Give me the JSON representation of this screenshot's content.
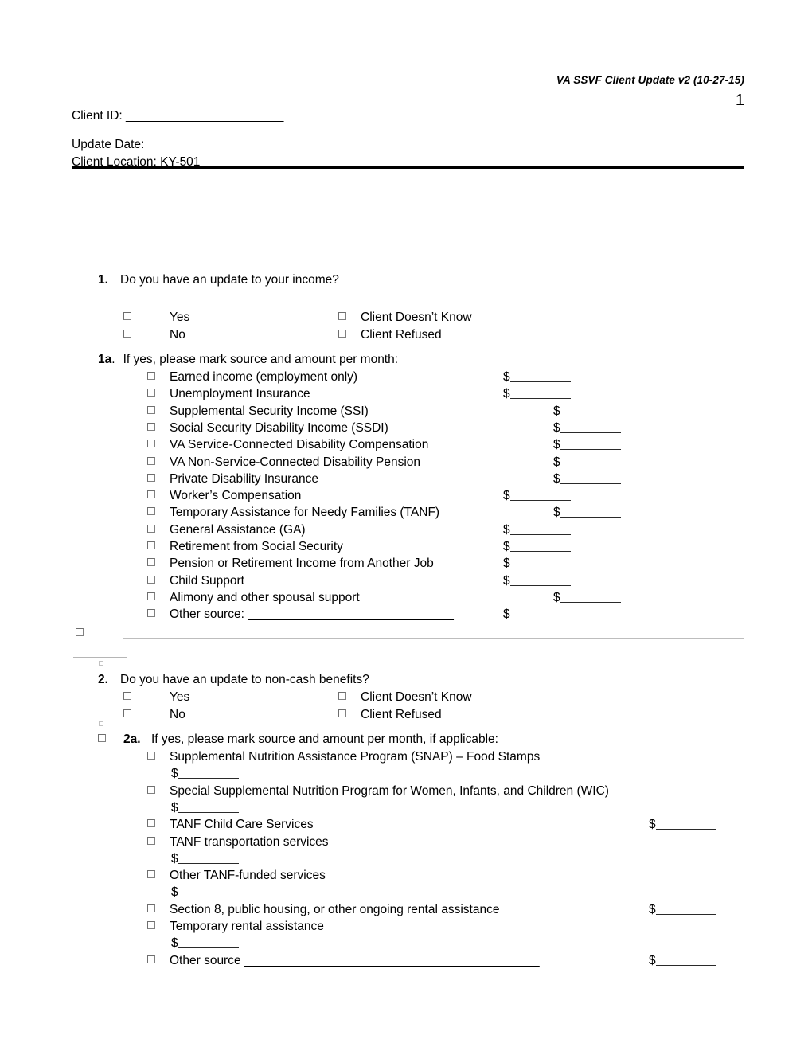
{
  "header": {
    "doc_title": "VA SSVF Client Update v2 (10-27-15)",
    "page_number": "1"
  },
  "client_info": {
    "client_id_label": "Client ID: _______________________",
    "update_date_label": "Update Date: ____________________",
    "client_location_label": "Client Location: KY-501"
  },
  "question1": {
    "number": "1.",
    "text": "Do you have an update to your income?",
    "options": [
      {
        "label": "Yes"
      },
      {
        "label": "No"
      },
      {
        "label": "Client Doesn’t Know"
      },
      {
        "label": "Client Refused"
      }
    ],
    "sub": {
      "number": "1a",
      "dot": ".",
      "text": "If yes, please mark source and amount per month:"
    },
    "sources": [
      {
        "label": "Earned income (employment only)",
        "amount_symbol": "$",
        "amount_col": "left"
      },
      {
        "label": "Unemployment Insurance",
        "amount_symbol": "$",
        "amount_col": "left"
      },
      {
        "label": "Supplemental Security Income (SSI)",
        "amount_symbol": "$",
        "amount_col": "right"
      },
      {
        "label": "Social Security Disability Income (SSDI)",
        "amount_symbol": "$",
        "amount_col": "right"
      },
      {
        "label": "VA Service-Connected Disability Compensation",
        "amount_symbol": "$",
        "amount_col": "right"
      },
      {
        "label": "VA Non-Service-Connected Disability Pension",
        "amount_symbol": "$",
        "amount_col": "right"
      },
      {
        "label": "Private Disability Insurance",
        "amount_symbol": "$",
        "amount_col": "right"
      },
      {
        "label": "Worker’s Compensation",
        "amount_symbol": "$",
        "amount_col": "left"
      },
      {
        "label": "Temporary Assistance for Needy Families (TANF)",
        "amount_symbol": "$",
        "amount_col": "right"
      },
      {
        "label": "General Assistance (GA)",
        "amount_symbol": "$",
        "amount_col": "left"
      },
      {
        "label": "Retirement from Social Security",
        "amount_symbol": "$",
        "amount_col": "left"
      },
      {
        "label": "Pension or Retirement Income from Another Job",
        "amount_symbol": "$",
        "amount_col": "left"
      },
      {
        "label": "Child Support",
        "amount_symbol": "$",
        "amount_col": "left"
      },
      {
        "label": "Alimony and other spousal support",
        "amount_symbol": "$",
        "amount_col": "right"
      },
      {
        "label": "Other source: ______________________________",
        "amount_symbol": "$",
        "amount_col": "left"
      }
    ]
  },
  "question2": {
    "number": "2.",
    "text": "Do you have an update to non-cash benefits?",
    "options": [
      {
        "label": "Yes"
      },
      {
        "label": "No"
      },
      {
        "label": "Client Doesn’t Know"
      },
      {
        "label": "Client Refused"
      }
    ],
    "sub": {
      "number": "2a.",
      "text": "If yes, please mark source and amount per month, if applicable:"
    },
    "sources": [
      {
        "label": "Supplemental Nutrition Assistance Program (SNAP) – Food Stamps",
        "amount_symbol": "$",
        "amount_col": "wrap"
      },
      {
        "label": "Special Supplemental Nutrition Program for Women, Infants, and Children (WIC)",
        "amount_symbol": "$",
        "amount_col": "wrap"
      },
      {
        "label": "TANF Child Care Services",
        "amount_symbol": "$",
        "amount_col": "far"
      },
      {
        "label": "TANF transportation services",
        "amount_symbol": "$",
        "amount_col": "wrap"
      },
      {
        "label": "Other TANF-funded services",
        "amount_symbol": "$",
        "amount_col": "wrap"
      },
      {
        "label": "Section 8, public housing, or other ongoing rental assistance",
        "amount_symbol": "$",
        "amount_col": "far"
      },
      {
        "label": "Temporary rental assistance",
        "amount_symbol": "$",
        "amount_col": "wrap"
      },
      {
        "label": "Other source ___________________________________________",
        "amount_symbol": "$",
        "amount_col": "far"
      }
    ]
  }
}
